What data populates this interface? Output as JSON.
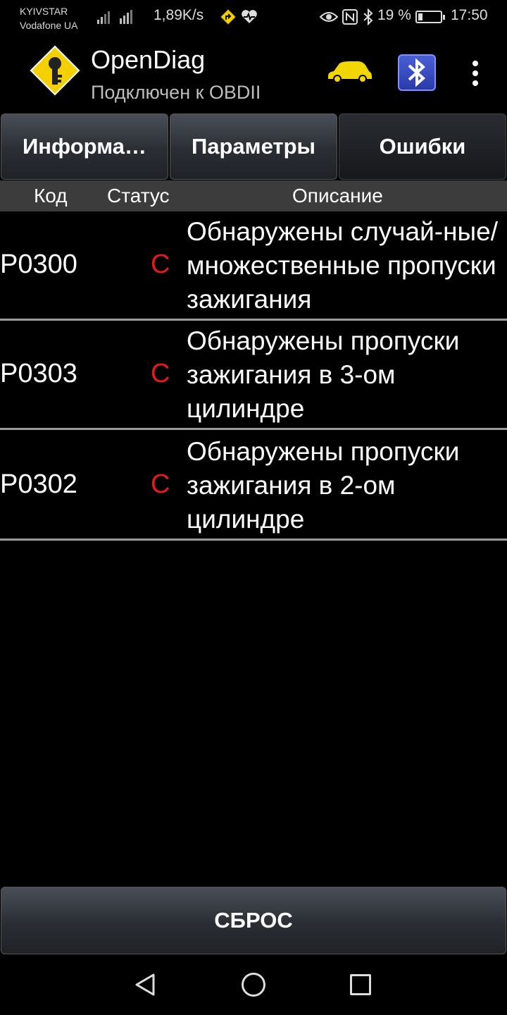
{
  "status_bar": {
    "carrier1": "KYIVSTAR",
    "carrier2": "Vodafone UA",
    "net_speed": "1,89K/s",
    "battery_pct": "19 %",
    "battery_level": 0.19,
    "time": "17:50",
    "icons": [
      "signal-icon",
      "signal-hplus-icon",
      "road-sign-icon",
      "heart-monitor-icon",
      "eye-icon",
      "nfc-icon",
      "bluetooth-icon",
      "battery-icon"
    ]
  },
  "app_bar": {
    "title": "OpenDiag",
    "subtitle": "Подключен к OBDII",
    "icons": [
      "app-logo-icon",
      "car-icon",
      "bluetooth-elm-icon",
      "overflow-menu-icon"
    ]
  },
  "tabs": [
    {
      "label": "Информа…",
      "active": false
    },
    {
      "label": "Параметры",
      "active": false
    },
    {
      "label": "Ошибки",
      "active": true
    }
  ],
  "table": {
    "columns": [
      "Код",
      "Статус",
      "Описание"
    ],
    "rows": [
      {
        "code": "P0300",
        "status": "C",
        "description": "Обнаружены случай-ные/множественные пропуски зажигания"
      },
      {
        "code": "P0303",
        "status": "C",
        "description": "Обнаружены пропуски зажигания в 3-ом цилиндре"
      },
      {
        "code": "P0302",
        "status": "C",
        "description": "Обнаружены пропуски зажигания в 2-ом цилиндре"
      }
    ]
  },
  "reset_button": "СБРОС",
  "colors": {
    "status_error": "#e01b1b",
    "logo_yellow": "#f5d000",
    "car_yellow": "#f2d600",
    "bluetooth_blue": "#3a4fd0"
  }
}
